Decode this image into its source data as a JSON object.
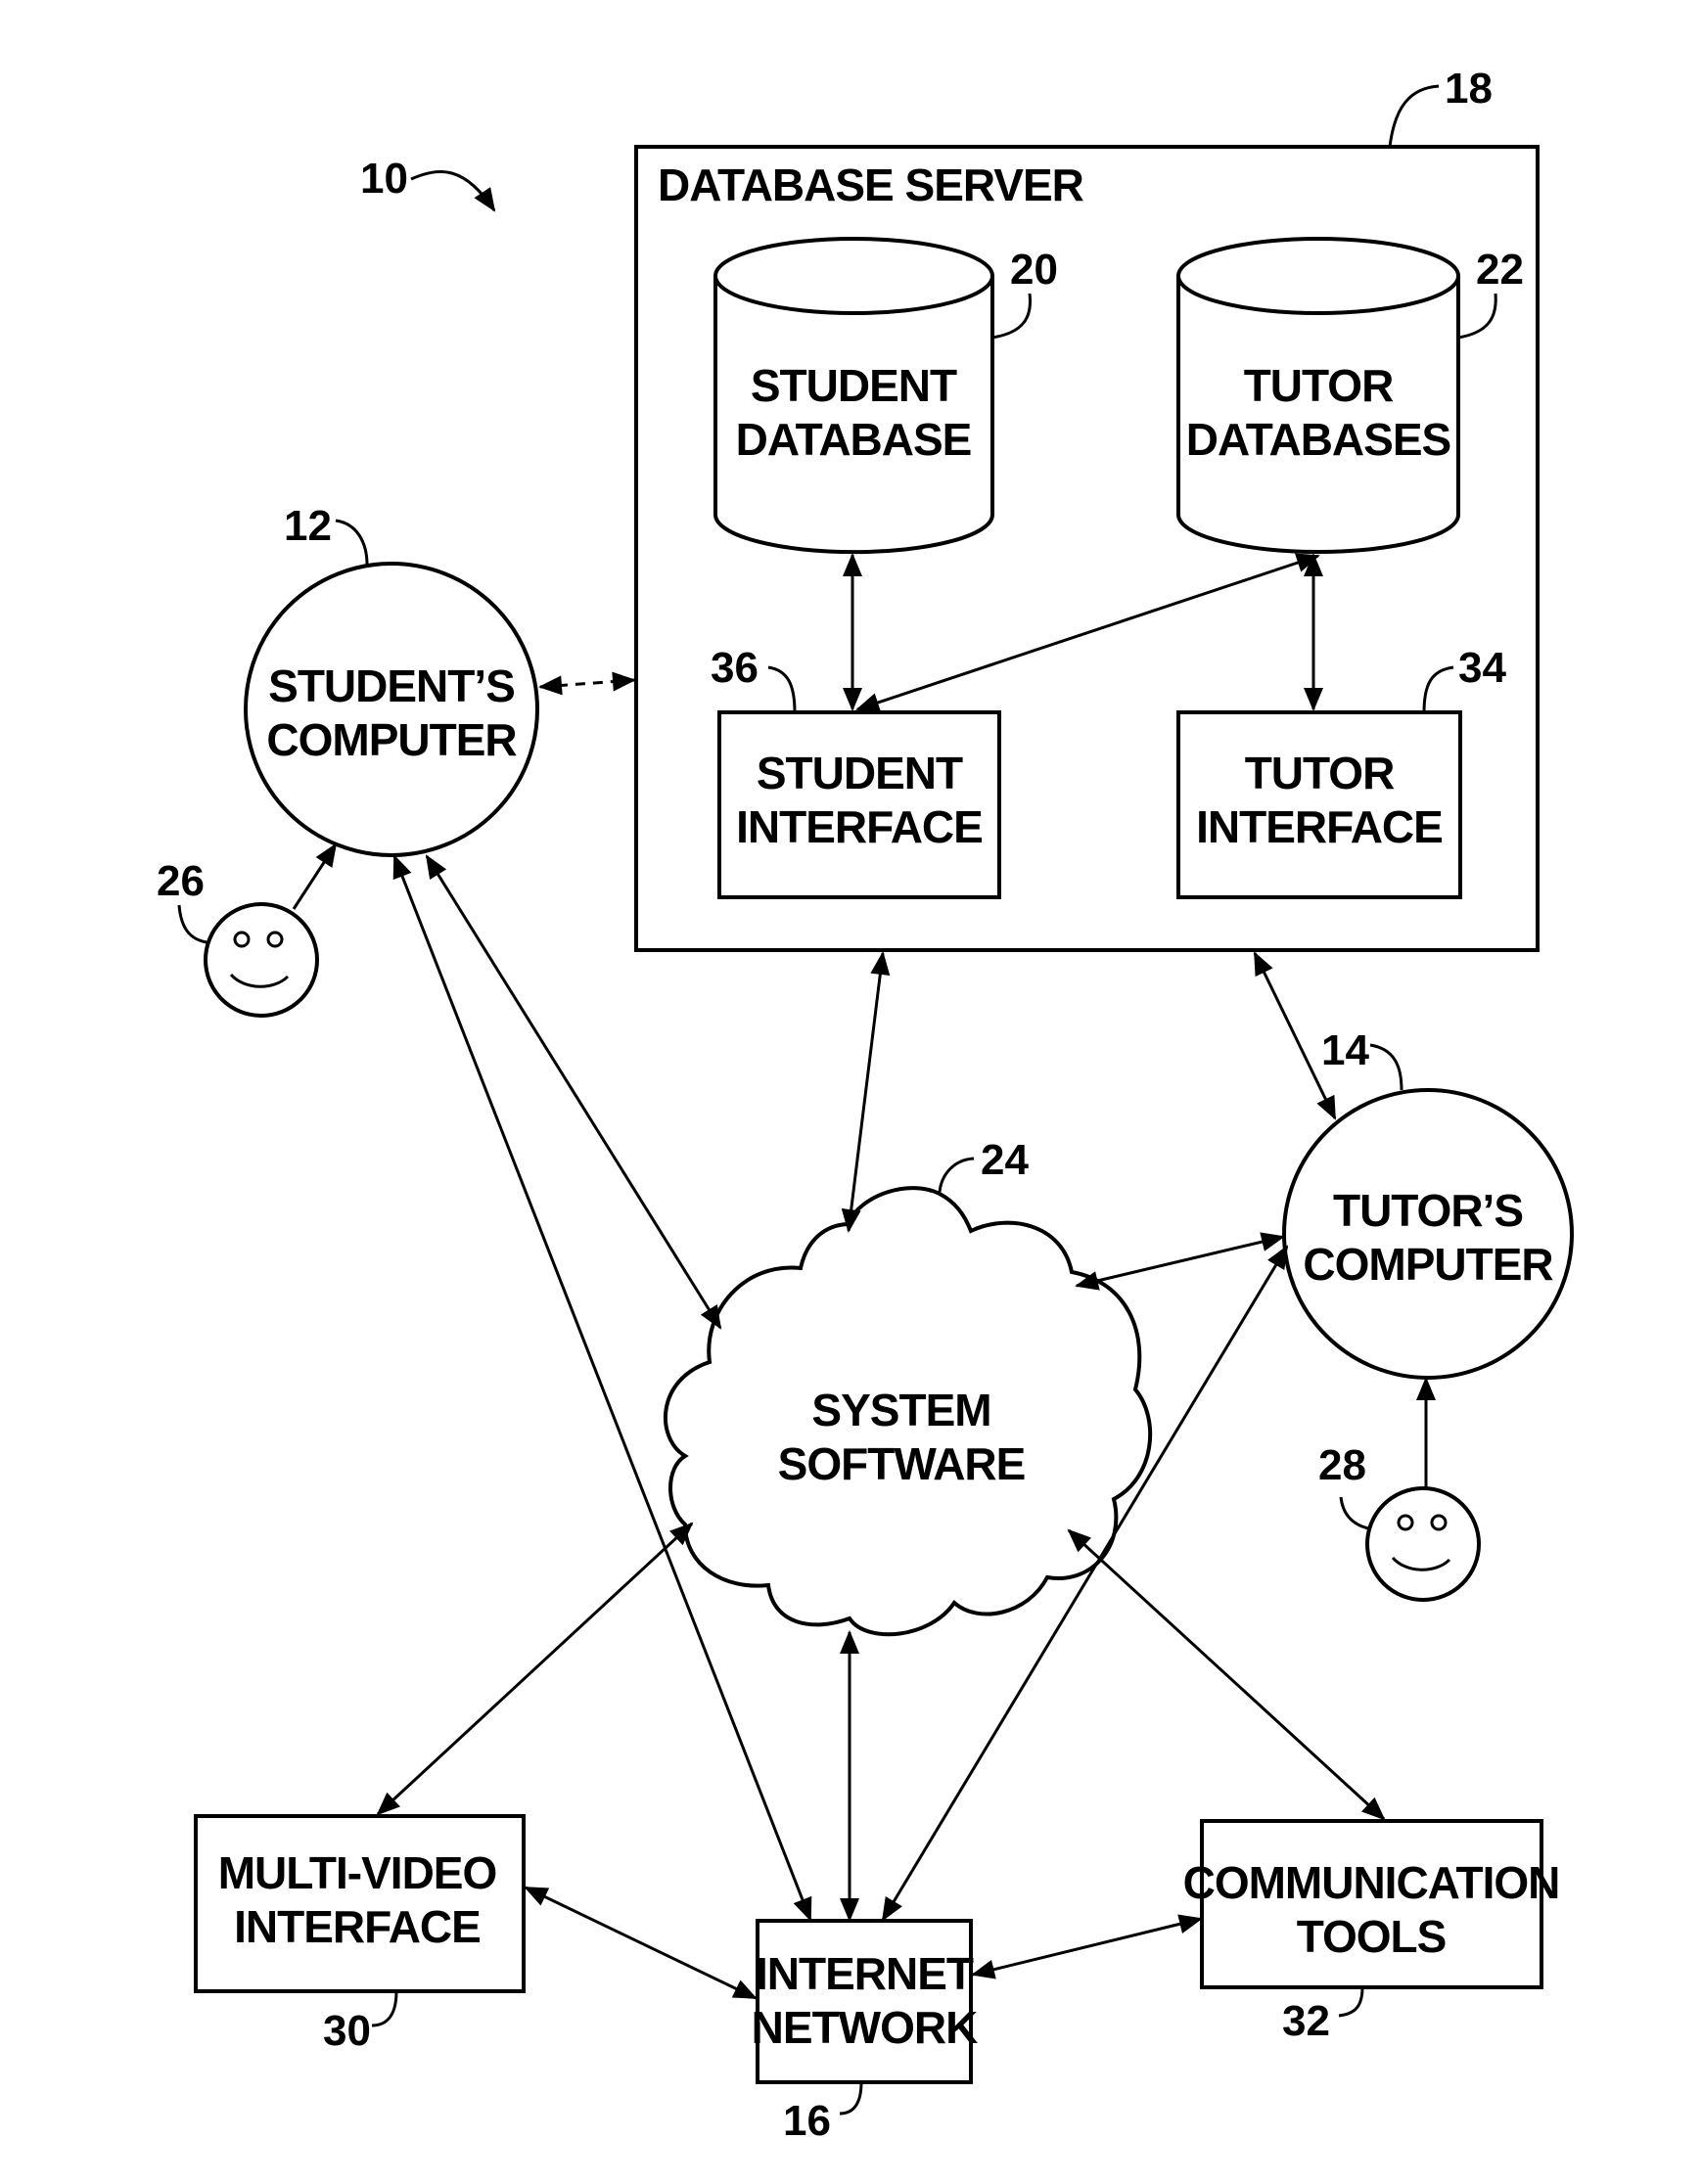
{
  "figure_ref": "10",
  "database_server": {
    "label": "DATABASE SERVER",
    "ref": "18"
  },
  "student_database": {
    "lines": [
      "STUDENT",
      "DATABASE"
    ],
    "ref": "20"
  },
  "tutor_databases": {
    "lines": [
      "TUTOR",
      "DATABASES"
    ],
    "ref": "22"
  },
  "student_interface": {
    "lines": [
      "STUDENT",
      "INTERFACE"
    ],
    "ref": "36"
  },
  "tutor_interface": {
    "lines": [
      "TUTOR",
      "INTERFACE"
    ],
    "ref": "34"
  },
  "students_computer": {
    "lines": [
      "STUDENT’S",
      "COMPUTER"
    ],
    "ref": "12"
  },
  "tutors_computer": {
    "lines": [
      "TUTOR’S",
      "COMPUTER"
    ],
    "ref": "14"
  },
  "system_software": {
    "lines": [
      "SYSTEM",
      "SOFTWARE"
    ],
    "ref": "24"
  },
  "multi_video_interface": {
    "lines": [
      "MULTI-VIDEO",
      "INTERFACE"
    ],
    "ref": "30"
  },
  "internet_network": {
    "lines": [
      "INTERNET",
      "NETWORK"
    ],
    "ref": "16"
  },
  "communication_tools": {
    "lines": [
      "COMMUNICATION",
      "TOOLS"
    ],
    "ref": "32"
  },
  "student_user": {
    "icon": "smiley-face-icon",
    "ref": "26"
  },
  "tutor_user": {
    "icon": "smiley-face-icon",
    "ref": "28"
  }
}
